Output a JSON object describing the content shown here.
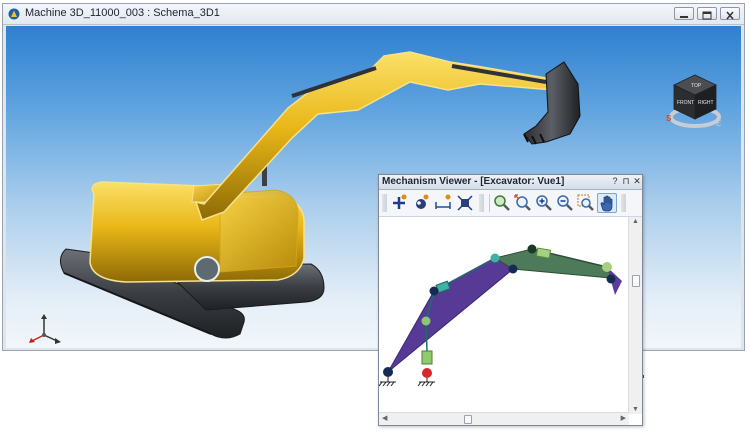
{
  "window": {
    "title": "Machine 3D_11000_003 : Schema_3D1",
    "buttons": [
      "minimize",
      "restore",
      "close"
    ]
  },
  "viewcube": {
    "faces": [
      "TOP",
      "FRONT",
      "RIGHT"
    ],
    "compass": [
      "S",
      "E"
    ]
  },
  "mechanism_viewer": {
    "title": "Mechanism Viewer - [Excavator: Vue1]",
    "title_buttons": [
      "?",
      "⊓",
      "✕"
    ],
    "toolbar_group1": [
      "add-joint-icon",
      "show-joints-icon",
      "measure-icon",
      "fit-icon"
    ],
    "toolbar_group2": [
      "zoom-area-icon",
      "zoom-select-icon",
      "zoom-in-icon",
      "zoom-out-icon",
      "zoom-window-icon",
      "pan-hand-icon"
    ],
    "active_tool": "pan-hand-icon"
  },
  "colors": {
    "machine_yellow": "#e7b416",
    "track_dark": "#3a3d42",
    "boom_purple": "#5a3d9a",
    "arm_green": "#4d7b5a",
    "joint_navy": "#162a52",
    "joint_green": "#8cc870",
    "joint_teal": "#3fb1a6",
    "ground_red": "#d8262a",
    "sky_top": "#2e80cf"
  }
}
